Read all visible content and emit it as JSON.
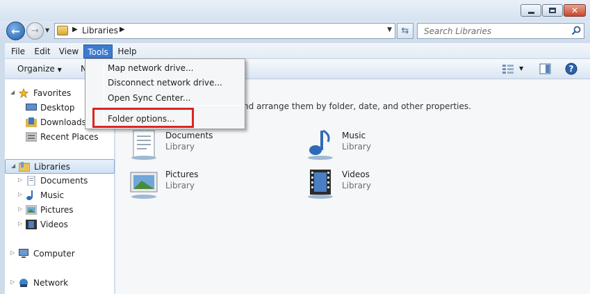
{
  "window": {
    "controls": [
      "minimize",
      "maximize",
      "close"
    ]
  },
  "nav": {
    "address_segment": "Libraries",
    "search_placeholder": "Search Libraries"
  },
  "menubar": {
    "items": [
      "File",
      "Edit",
      "View",
      "Tools",
      "Help"
    ],
    "active": "Tools"
  },
  "toolbar": {
    "organize_label": "Organize",
    "hidden_label_peek": "N"
  },
  "tools_menu": {
    "items": [
      "Map network drive...",
      "Disconnect network drive...",
      "Open Sync Center...",
      "Folder options..."
    ],
    "highlighted": "Folder options..."
  },
  "navpane": {
    "favorites_label": "Favorites",
    "favorites": [
      "Desktop",
      "Downloads",
      "Recent Places"
    ],
    "libraries_label": "Libraries",
    "libraries": [
      "Documents",
      "Music",
      "Pictures",
      "Videos"
    ],
    "computer_label": "Computer",
    "network_label": "Network"
  },
  "content": {
    "description": "nd arrange them by folder, date, and other properties.",
    "libraries": [
      {
        "name": "Documents",
        "type": "Library",
        "icon": "documents-library-icon"
      },
      {
        "name": "Music",
        "type": "Library",
        "icon": "music-library-icon"
      },
      {
        "name": "Pictures",
        "type": "Library",
        "icon": "pictures-library-icon"
      },
      {
        "name": "Videos",
        "type": "Library",
        "icon": "videos-library-icon"
      }
    ]
  },
  "colors": {
    "menu_active": "#3b7bd2",
    "highlight_box": "#d92424",
    "chrome": "#cfdcec"
  }
}
